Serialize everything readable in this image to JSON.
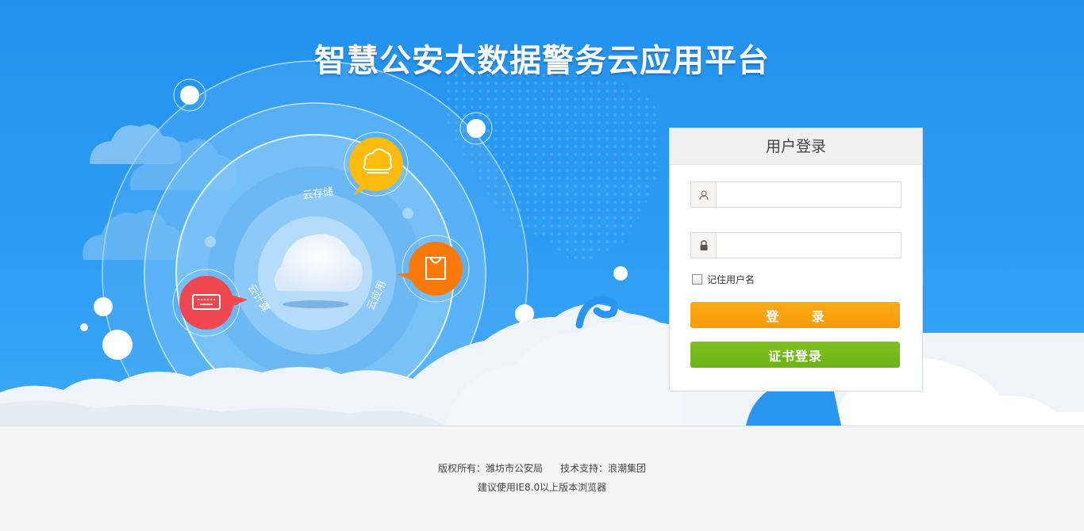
{
  "header": {
    "title": "智慧公安大数据警务云应用平台"
  },
  "diagram": {
    "labels": [
      "云存储",
      "云应用",
      "云计算"
    ]
  },
  "login": {
    "title": "用户登录",
    "username_value": "",
    "password_value": "",
    "remember_label": "记住用户名",
    "login_button": "登 录",
    "cert_button": "证书登录"
  },
  "footer": {
    "copyright": "版权所有：潍坊市公安局",
    "support": "技术支持：浪潮集团",
    "browser_hint": "建议使用IE8.0以上版本浏览器"
  },
  "colors": {
    "background_blue": "#2191ee",
    "login_orange": "#f79a06",
    "cert_green": "#6cb316",
    "storage_yellow": "#fbbb0a",
    "app_orange": "#f97a0b",
    "compute_red": "#ee4750"
  }
}
